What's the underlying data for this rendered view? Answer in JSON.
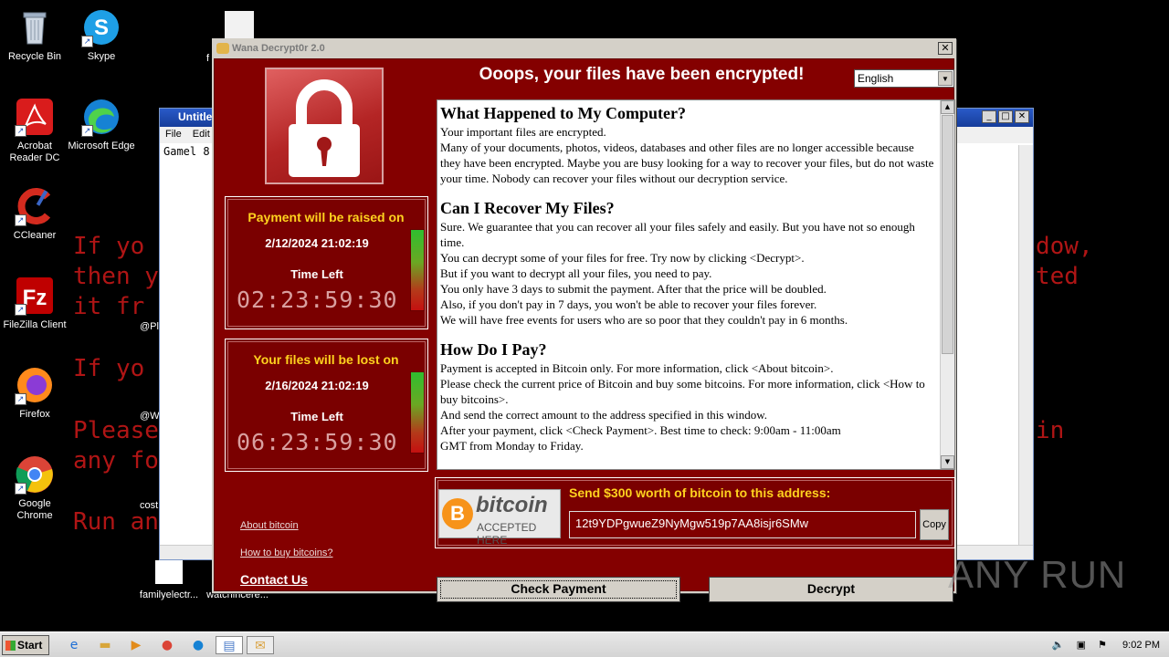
{
  "desktop": {
    "icons": [
      {
        "label": "Recycle Bin"
      },
      {
        "label": "Skype"
      },
      {
        "label": "Acrobat Reader DC"
      },
      {
        "label": "Microsoft Edge"
      },
      {
        "label": "CCleaner"
      },
      {
        "label": "FileZilla Client"
      },
      {
        "label": "Firefox"
      },
      {
        "label": "Google Chrome"
      },
      {
        "label": "familyelectr..."
      },
      {
        "label": "watchincere..."
      }
    ],
    "background_lines": {
      "l1": "If yo",
      "l2": "then y",
      "l3": "it fr",
      "l4": "If yo",
      "l5": "Please",
      "l6": "any fo",
      "l7": "Run an",
      "r1": "dow,",
      "r2": "ted",
      "r3": "in"
    },
    "partial_labels": {
      "p1": "f",
      "p2": "@Pl",
      "p3": "@W",
      "p4": "cost"
    }
  },
  "notepad": {
    "title": "Untitle",
    "menu": [
      "File",
      "Edit"
    ],
    "content": "Gamel 8"
  },
  "window": {
    "title": "Wana Decrypt0r 2.0",
    "close": "✕",
    "headline": "Ooops, your files have been encrypted!",
    "language": "English",
    "timer1": {
      "title": "Payment will be raised on",
      "date": "2/12/2024 21:02:19",
      "time_left_label": "Time Left",
      "countdown": "02:23:59:30"
    },
    "timer2": {
      "title": "Your files will be lost on",
      "date": "2/16/2024 21:02:19",
      "time_left_label": "Time Left",
      "countdown": "06:23:59:30"
    },
    "links": {
      "about": "About bitcoin",
      "howto": "How to buy bitcoins?",
      "contact": "Contact Us"
    },
    "message": {
      "h1": "What Happened to My Computer?",
      "p1a": "Your important files are encrypted.",
      "p1b": "Many of your documents, photos, videos, databases and other files are no longer accessible because they have been encrypted. Maybe you are busy looking for a way to recover your files, but do not waste your time. Nobody can recover your files without our decryption service.",
      "h2": "Can I Recover My Files?",
      "p2a": "Sure. We guarantee that you can recover all your files safely and easily. But you have not so enough time.",
      "p2b": "You can decrypt some of your files for free. Try now by clicking <Decrypt>.",
      "p2c": "But if you want to decrypt all your files, you need to pay.",
      "p2d": "You only have 3 days to submit the payment. After that the price will be doubled.",
      "p2e": "Also, if you don't pay in 7 days, you won't be able to recover your files forever.",
      "p2f": "We will have free events for users who are so poor that they couldn't pay in 6 months.",
      "h3": "How Do I Pay?",
      "p3a": "Payment is accepted in Bitcoin only. For more information, click <About bitcoin>.",
      "p3b": "Please check the current price of Bitcoin and buy some bitcoins. For more information, click <How to buy bitcoins>.",
      "p3c": "And send the correct amount to the address specified in this window.",
      "p3d": "After your payment, click <Check Payment>. Best time to check: 9:00am - 11:00am",
      "p3e": "GMT from Monday to Friday."
    },
    "bitcoin_logo": {
      "b": "B",
      "word": "bitcoin",
      "sub": "ACCEPTED HERE"
    },
    "send_label": "Send $300 worth of bitcoin to this address:",
    "address": "12t9YDPgwueZ9NyMgw519p7AA8isjr6SMw",
    "copy": "Copy",
    "check_payment": "Check Payment",
    "decrypt": "Decrypt"
  },
  "taskbar": {
    "start": "Start",
    "clock": "9:02 PM"
  },
  "watermark": "ANY RUN"
}
